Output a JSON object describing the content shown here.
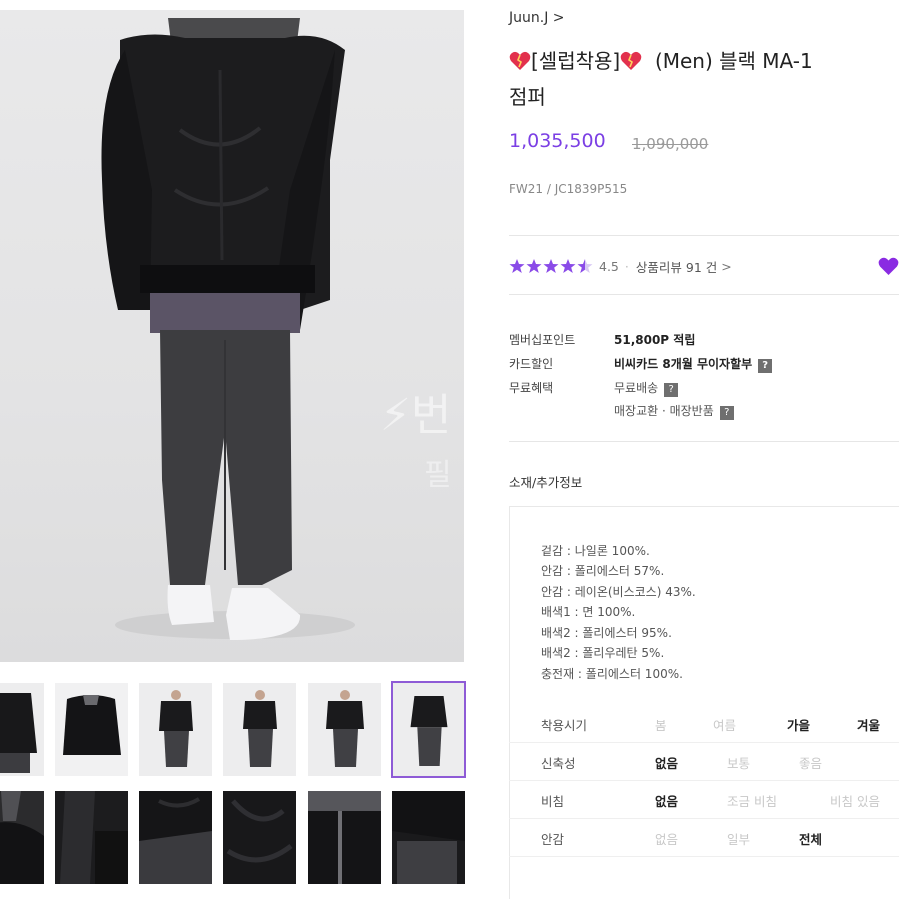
{
  "brand": {
    "name": "Juun.J >"
  },
  "title": {
    "line1": "[셀럽착용]",
    "line1_rest": "(Men) 블랙 MA-1",
    "line2": "점퍼"
  },
  "price": {
    "sale": "1,035,500",
    "original": "1,090,000",
    "accent": "#7b3fe4"
  },
  "product_code": "FW21 / JC1839P515",
  "rating": {
    "score": "4.5",
    "stars_filled": 4.5,
    "stars_total": 5,
    "review_label": "상품리뷰",
    "review_count": "91 건",
    "chevron": ">"
  },
  "benefits": [
    {
      "label": "멤버십포인트",
      "value": "51,800P 적립"
    },
    {
      "label": "카드할인",
      "value": "비씨카드 8개월 무이자할부",
      "help": "?"
    },
    {
      "label": "무료혜택",
      "value": "무료배송",
      "help": "?"
    },
    {
      "label": "",
      "value": "매장교환 · 매장반품",
      "help": "?"
    }
  ],
  "section_title": "소재/추가정보",
  "materials": [
    "겉감 : 나일론 100%.",
    "안감 : 폴리에스터 57%.",
    "안감 : 레이온(비스코스) 43%.",
    "배색1 : 면 100%.",
    "배색2 : 폴리에스터 95%.",
    "배색2 : 폴리우레탄 5%.",
    "충전재 : 폴리에스터 100%."
  ],
  "specs": [
    {
      "label": "착용시기",
      "options": [
        "봄",
        "여름",
        "가을",
        "겨울"
      ],
      "selected": [
        "가을",
        "겨울"
      ]
    },
    {
      "label": "신축성",
      "options": [
        "없음",
        "보통",
        "좋음"
      ],
      "selected": [
        "없음"
      ]
    },
    {
      "label": "비침",
      "options": [
        "없음",
        "조금 비침",
        "비침 있음"
      ],
      "selected": [
        "없음"
      ]
    },
    {
      "label": "안감",
      "options": [
        "없음",
        "일부",
        "전체"
      ],
      "selected": [
        "전체"
      ]
    }
  ],
  "icons": {
    "heart_badge": "broken-heart-icon",
    "favorite": "heart-icon",
    "help": "help-icon"
  },
  "colors": {
    "accent_purple": "#7b3fe4",
    "star_purple": "#8a4be8"
  }
}
